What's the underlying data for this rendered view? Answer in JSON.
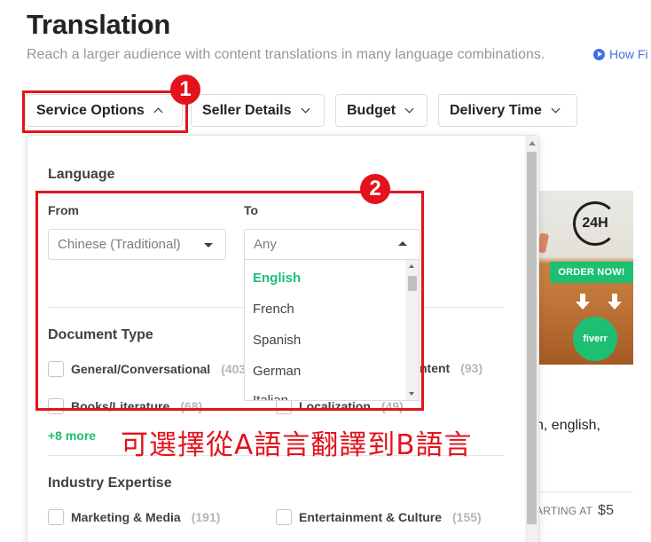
{
  "page": {
    "title": "Translation",
    "subtitle": "Reach a larger audience with content translations in many language combinations.",
    "how_link": "How Fi"
  },
  "filters": [
    {
      "label": "Service Options",
      "open": true
    },
    {
      "label": "Seller Details"
    },
    {
      "label": "Budget"
    },
    {
      "label": "Delivery Time"
    }
  ],
  "badges": {
    "one": "1",
    "two": "2"
  },
  "panel": {
    "language_heading": "Language",
    "from_label": "From",
    "to_label": "To",
    "from_value": "Chinese (Traditional)",
    "to_placeholder": "Any",
    "to_options": [
      "English",
      "French",
      "Spanish",
      "German",
      "Italian"
    ],
    "to_options_highlighted": "English",
    "document_type_heading": "Document Type",
    "document_types": [
      {
        "label": "General/Conversational",
        "count": "(403"
      },
      {
        "label": "ntent",
        "count": "(93)"
      },
      {
        "label": "Books/Literature",
        "count": "(68)"
      },
      {
        "label": "Localization",
        "count": "(49)"
      }
    ],
    "more_link": "+8 more",
    "industry_heading": "Industry Expertise",
    "industries": [
      {
        "label": "Marketing & Media",
        "count": "(191)"
      },
      {
        "label": "Entertainment & Culture",
        "count": "(155)"
      }
    ]
  },
  "gig": {
    "image_24": "24H",
    "order_button": "ORDER NOW!",
    "logo": "fiverr",
    "description": "n, english,",
    "starting_at": "ARTING AT",
    "price": "$5"
  },
  "annotation": "可選擇從A語言翻譯到B語言",
  "colors": {
    "accent_red": "#e3131c",
    "brand_green": "#1dbf73",
    "link_blue": "#446ee7"
  }
}
